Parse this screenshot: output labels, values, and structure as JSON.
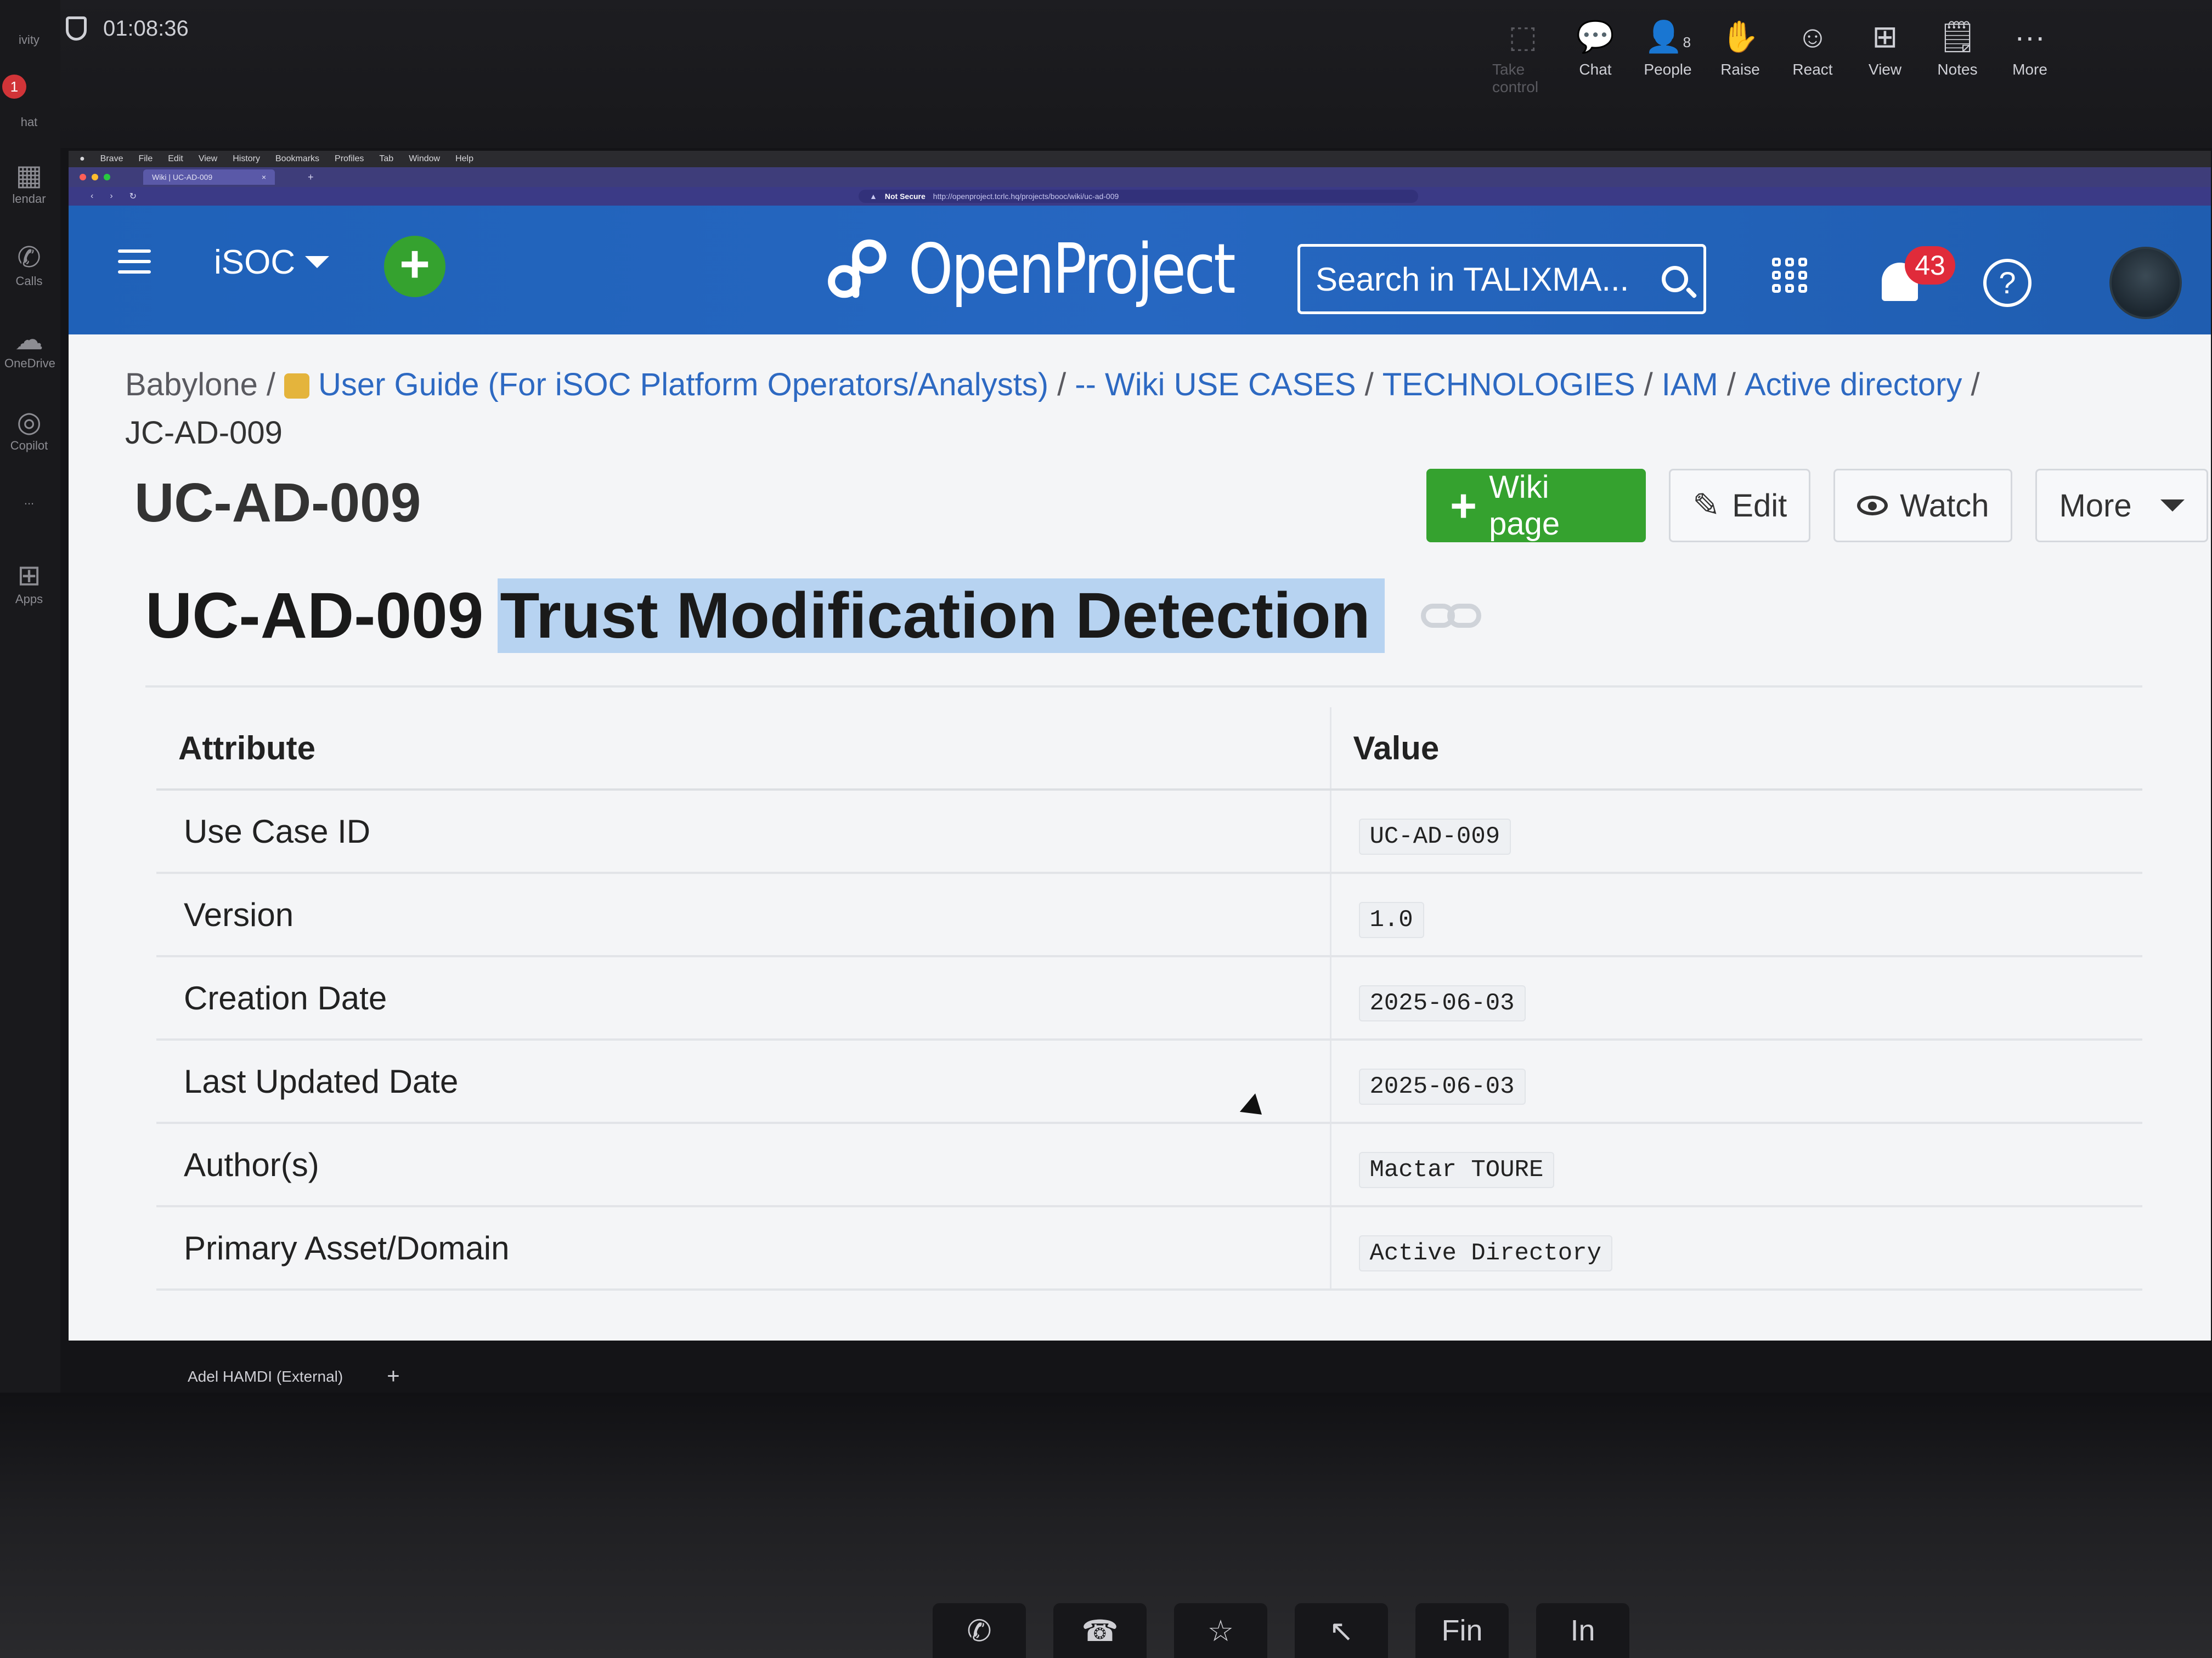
{
  "teams": {
    "timer": "01:08:36",
    "controls": [
      {
        "label": "Take control",
        "icon": "take-control-icon",
        "glyph": "⬚"
      },
      {
        "label": "Chat",
        "icon": "chat-icon",
        "glyph": "💬"
      },
      {
        "label": "People",
        "icon": "people-icon",
        "glyph": "👤"
      },
      {
        "label": "Raise",
        "icon": "raise-hand-icon",
        "glyph": "✋"
      },
      {
        "label": "React",
        "icon": "react-icon",
        "glyph": "☺"
      },
      {
        "label": "View",
        "icon": "view-icon",
        "glyph": "⊞"
      },
      {
        "label": "Notes",
        "icon": "notes-icon",
        "glyph": "🗒"
      },
      {
        "label": "More",
        "icon": "more-icon",
        "glyph": "···"
      }
    ],
    "people_count": "8",
    "rail": [
      "ivity",
      "hat",
      "lendar",
      "Calls",
      "OneDrive",
      "Copilot",
      "...",
      "Apps"
    ],
    "rail_badge": "1",
    "presenter": "Adel HAMDI (External)",
    "add_symbol": "+"
  },
  "browser": {
    "menubar": [
      "Brave",
      "File",
      "Edit",
      "View",
      "History",
      "Bookmarks",
      "Profiles",
      "Tab",
      "Window",
      "Help"
    ],
    "tab_title": "Wiki | UC-AD-009",
    "security": "Not Secure",
    "url": "http://openproject.tcrlc.hq/projects/booc/wiki/uc-ad-009"
  },
  "header": {
    "project": "iSOC",
    "quick_add": "+",
    "logo": "OpenProject",
    "search_placeholder": "Search in TALIXMA...",
    "notification_count": "43",
    "help": "?"
  },
  "breadcrumb": {
    "items": [
      "Babylone",
      "User Guide (For iSOC Platform Operators/Analysts)",
      "-- Wiki USE CASES",
      "TECHNOLOGIES",
      "IAM",
      "Active directory"
    ],
    "current": "JC-AD-009",
    "separator": "/"
  },
  "page": {
    "title": "UC-AD-009",
    "buttons": {
      "wiki_page": "Wiki page",
      "edit": "Edit",
      "watch": "Watch",
      "more": "More"
    },
    "heading_prefix": "UC-AD-009",
    "heading_selected": "Trust Modification Detection"
  },
  "table": {
    "headers": [
      "Attribute",
      "Value"
    ],
    "rows": [
      {
        "attribute": "Use Case ID",
        "value": "UC-AD-009"
      },
      {
        "attribute": "Version",
        "value": "1.0"
      },
      {
        "attribute": "Creation Date",
        "value": "2025-06-03"
      },
      {
        "attribute": "Last Updated Date",
        "value": "2025-06-03"
      },
      {
        "attribute": "Author(s)",
        "value": "Mactar TOURE"
      },
      {
        "attribute": "Primary Asset/Domain",
        "value": "Active Directory"
      }
    ]
  },
  "keyboard": [
    "Fin",
    "In"
  ],
  "colors": {
    "header_blue": "#2667c1",
    "primary_green": "#35a22f",
    "badge_red": "#e02b3a",
    "selection": "#b7d3f1",
    "link_blue": "#2d69c2"
  }
}
